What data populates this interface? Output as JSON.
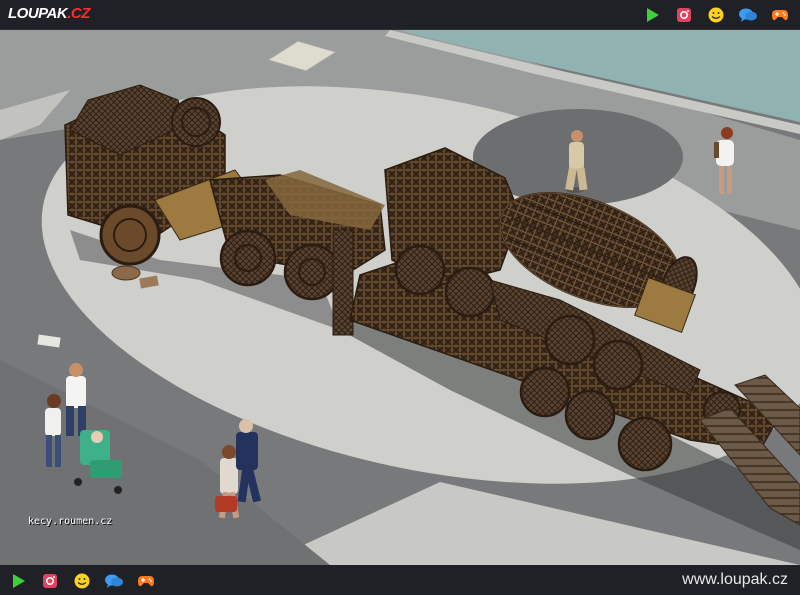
{
  "header": {
    "logo_main": "LOUPAK",
    "logo_tld": ".CZ",
    "icons": [
      "play-icon",
      "instagram-icon",
      "smiley-icon",
      "chat-icon",
      "gamepad-icon"
    ]
  },
  "photo": {
    "watermark": "kecy.roumen.cz"
  },
  "footer": {
    "site_url": "www.loupak.cz",
    "icons": [
      "play-icon",
      "instagram-icon",
      "smiley-icon",
      "chat-icon",
      "gamepad-icon"
    ]
  },
  "colors": {
    "bar_bg": "#1f2127",
    "play": "#3fcf3a",
    "instagram": "#e4405f",
    "smiley": "#ffd21e",
    "chat": "#3c9df2",
    "gamepad": "#ff7a1a",
    "logo_accent": "#ff2a2a"
  }
}
